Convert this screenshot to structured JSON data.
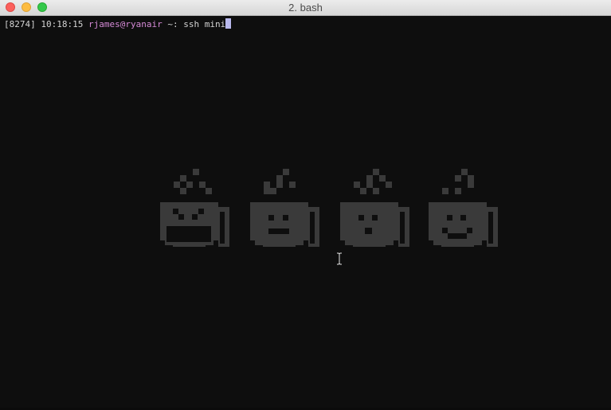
{
  "window": {
    "title": "2. bash",
    "controls": {
      "close": "close-button",
      "minimize": "minimize-button",
      "zoom": "zoom-button"
    }
  },
  "terminal": {
    "prompt": {
      "pid": "[8274]",
      "time": "10:18:15",
      "user_host": "rjames@ryanair",
      "path": "~:",
      "command": "ssh mini"
    },
    "colors": {
      "background": "#0e0e0e",
      "text": "#d4d4d4",
      "user_host": "#d58ad6",
      "cursor": "#b9b9ee",
      "art": "#3a3a3a"
    },
    "art": {
      "description_icon": "coffee-mug-faces-icon",
      "mugs": [
        {
          "face": "laughing"
        },
        {
          "face": "neutral"
        },
        {
          "face": "surprised"
        },
        {
          "face": "smiling"
        }
      ]
    },
    "pointer_icon": "ibeam-cursor-icon"
  }
}
